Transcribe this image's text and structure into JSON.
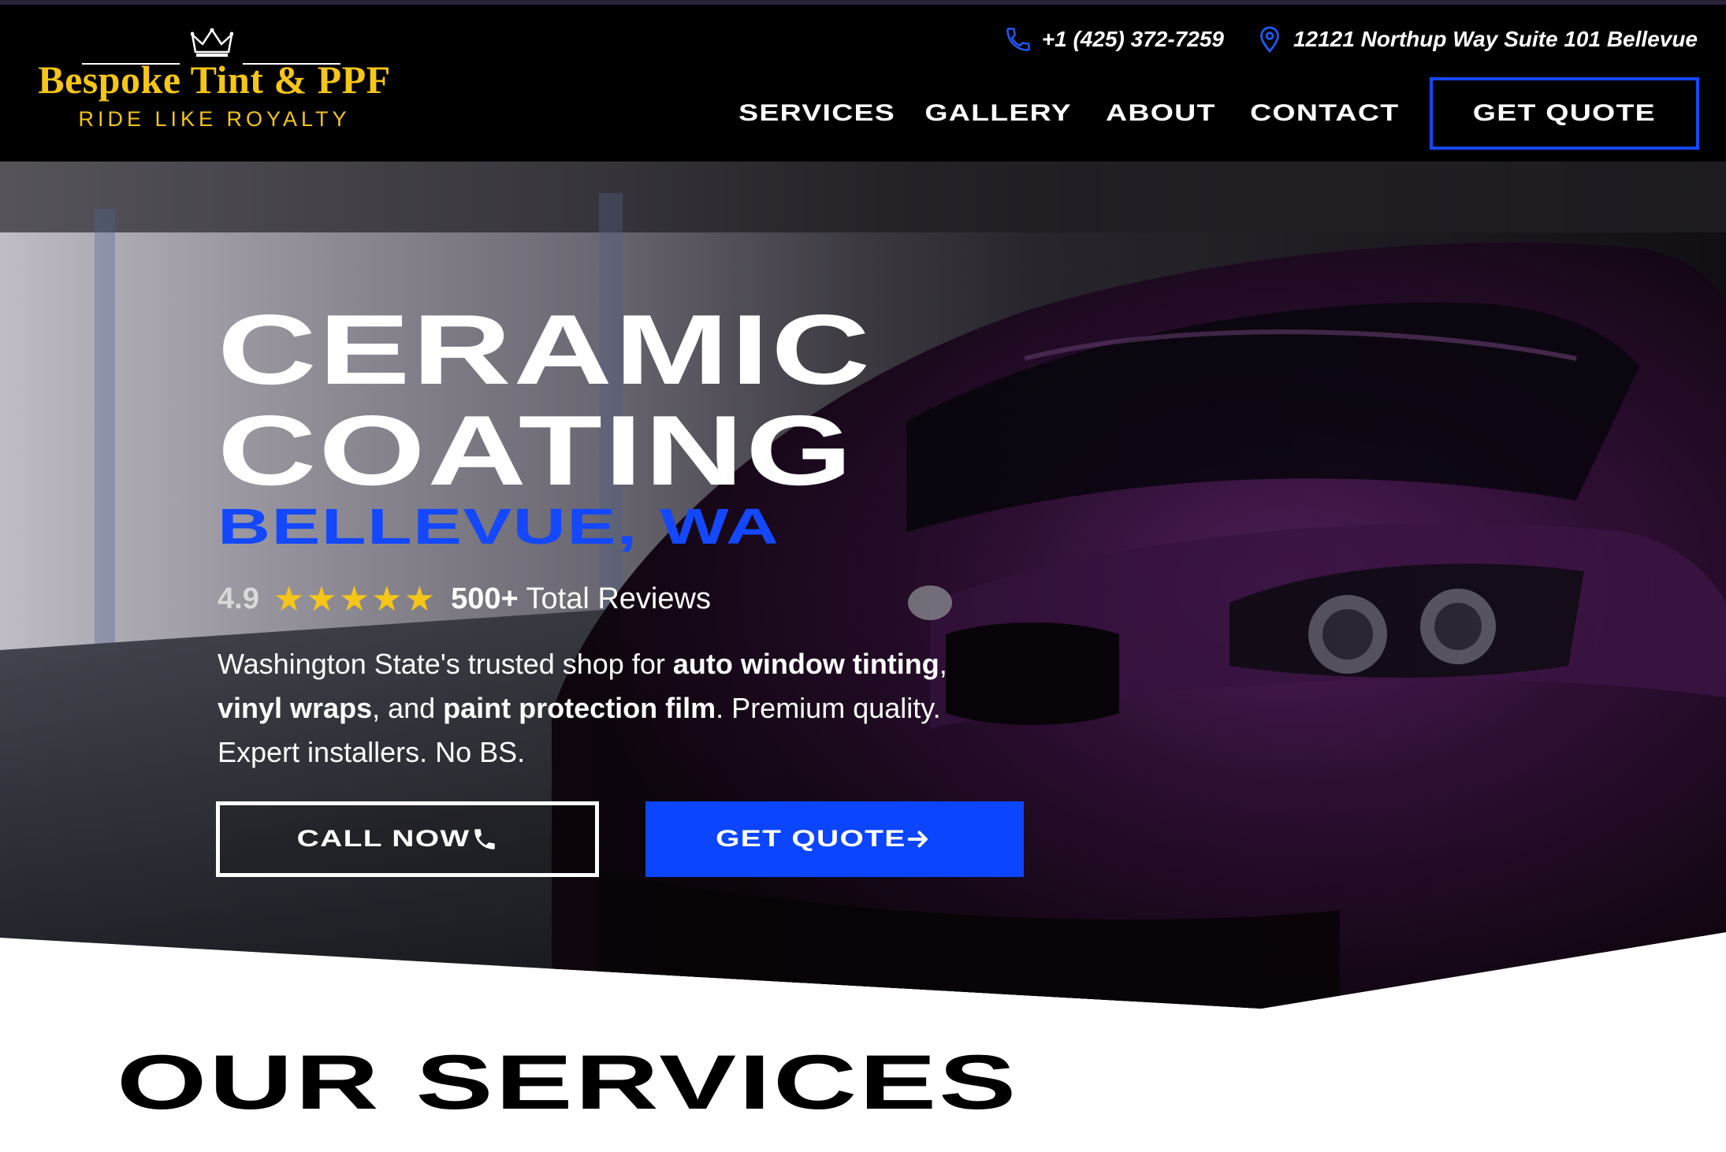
{
  "header": {
    "logo": {
      "brand": "Bespoke Tint & PPF",
      "tagline": "RIDE LIKE ROYALTY"
    },
    "contact": {
      "phone": "+1 (425) 372-7259",
      "address": "12121 Northup Way Suite 101 Bellevue"
    },
    "nav": {
      "items": [
        {
          "label": "SERVICES"
        },
        {
          "label": "GALLERY"
        },
        {
          "label": "ABOUT"
        },
        {
          "label": "CONTACT"
        }
      ],
      "quote_label": "GET QUOTE"
    }
  },
  "hero": {
    "title_line1": "CERAMIC",
    "title_line2": "COATING",
    "subtitle": "BELLEVUE, WA",
    "rating": {
      "score": "4.9",
      "stars": "★★★★★",
      "star_count": 5,
      "count_bold": "500+",
      "count_text": "Total Reviews"
    },
    "description": {
      "p1": "Washington State's trusted shop for ",
      "b1": "auto window tinting",
      "p2": ", ",
      "b2": "vinyl wraps",
      "p3": ", and ",
      "b3": "paint protection film",
      "p4": ". Premium quality. Expert installers. No BS."
    },
    "buttons": {
      "call_label": "CALL NOW",
      "quote_label": "GET QUOTE"
    }
  },
  "services": {
    "heading": "OUR SERVICES"
  },
  "colors": {
    "accent_blue": "#1448ff",
    "gold": "#f5c518",
    "header_bg": "#000000",
    "car_purple": "#3a1240"
  }
}
